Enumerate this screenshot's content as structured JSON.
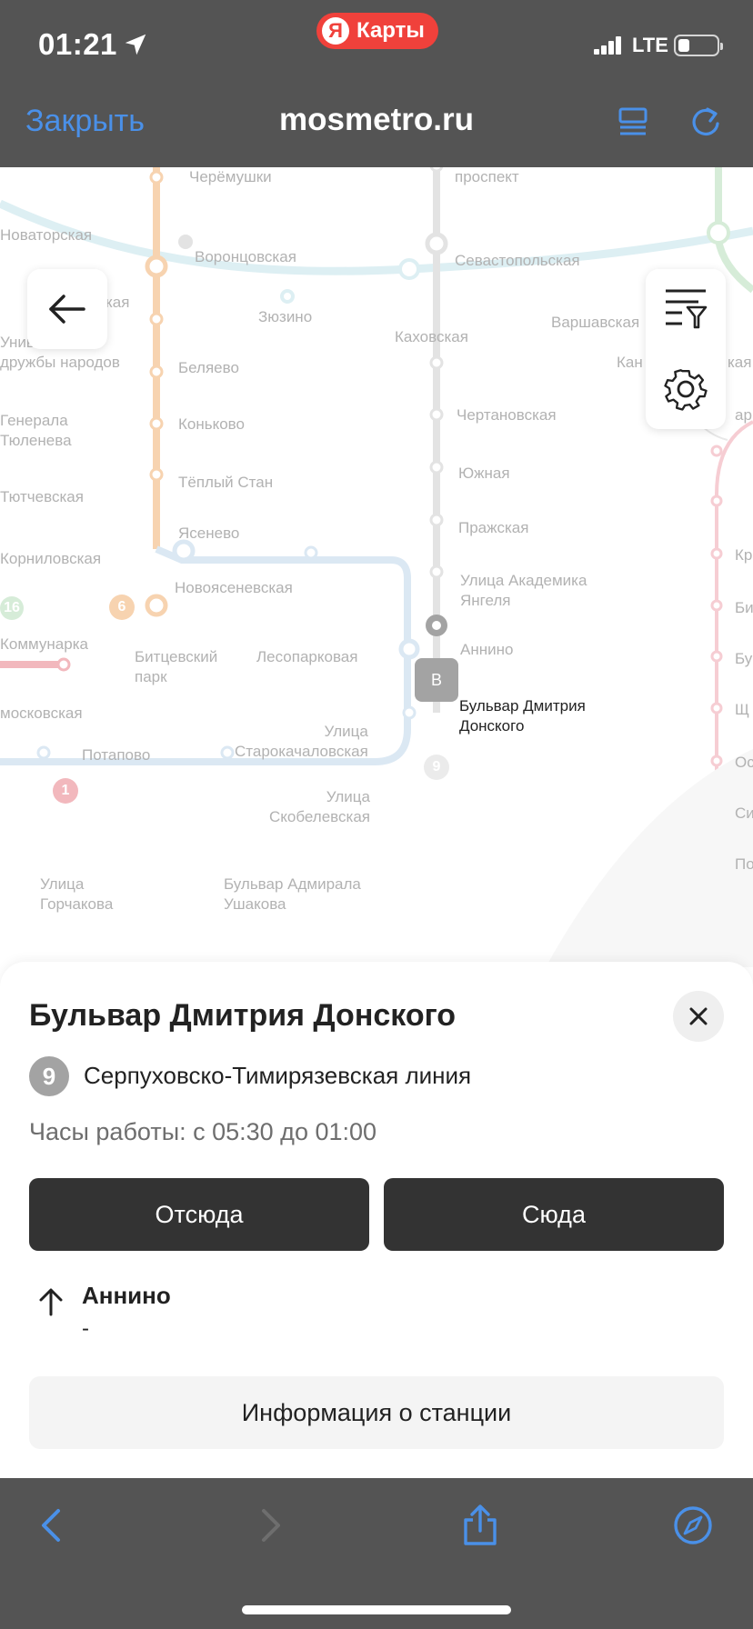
{
  "status_bar": {
    "time": "01:21",
    "app_pill": {
      "logo_letter": "Я",
      "label": "Карты"
    },
    "network": "LTE",
    "battery_level": 0.3
  },
  "nav_bar": {
    "close_label": "Закрыть",
    "title": "mosmetro.ru"
  },
  "map": {
    "labels": {
      "cheremushki": "Черёмушки",
      "prospekt": "проспект",
      "novatorskaya": "Новаторская",
      "vorontsovskaya": "Воронцовская",
      "sevastopolskaya": "Севастопольская",
      "kaya": "кая",
      "zyuzino": "Зюзино",
      "varshavskaya": "Варшавская",
      "kakhovskaya": "Каховская",
      "univ_druzhby": "Униве\nдружбы народов",
      "kan": "Кан",
      "kaya2": "кая",
      "belyaevo": "Беляево",
      "generala_tyuleneva": "Генерала\nТюленева",
      "chertanovskaya": "Чертановская",
      "kari": "ари",
      "konkovo": "Коньково",
      "teply_stan": "Тёплый Стан",
      "yuzhnaya": "Южная",
      "tyutchevskaya": "Тютчевская",
      "yasenevo": "Ясенево",
      "prazhskaya": "Пражская",
      "kr": "Кр",
      "kornilovskaya": "Корниловская",
      "ulitsa_ak_yangelya": "Улица Академика\nЯнгеля",
      "novoyasenevskaya": "Новоясеневская",
      "bi": "Би",
      "kommunarka": "Коммунарка",
      "bittsevsky_park": "Битцевский\nпарк",
      "lesoparkovaya": "Лесопарковая",
      "annino": "Аннино",
      "bu": "Бу",
      "moskovskaya": "московская",
      "bulvar_dm_donskogo": "Бульвар Дмитрия\nДонского",
      "shch": "Щ",
      "ulitsa_starokachalovskaya": "Улица\nСтарокачаловская",
      "potapovo": "Потапово",
      "os": "Ос",
      "ulitsa_skobelevskaya": "Улица\nСкобелевская",
      "si": "Си",
      "po": "По",
      "ulitsa_gorchakova": "Улица\nГорчакова",
      "bulvar_adm_ushakova": "Бульвар Адмирала\nУшакова"
    },
    "line_numbers": {
      "l16": "16",
      "l6": "6",
      "l1": "1",
      "l9": "9"
    },
    "marker_letter": "B",
    "colors": {
      "orange": "#f7d3b0",
      "grey": "#e3e3e3",
      "light_blue": "#ddeff3",
      "blue_ring": "#dbe8f3",
      "green": "#d6ecd8",
      "pink": "#f6cdd3",
      "red": "#f2b8bd"
    }
  },
  "sheet": {
    "station_name": "Бульвар Дмитрия Донского",
    "line_number": "9",
    "line_name": "Серпуховско-Тимирязевская линия",
    "hours": "Часы работы: с 05:30 до 01:00",
    "from_label": "Отсюда",
    "to_label": "Сюда",
    "direction": {
      "name": "Аннино",
      "time": "-"
    },
    "info_label": "Информация о станции",
    "line_color": "#a3a3a3"
  },
  "colors": {
    "chrome_bg": "#545454",
    "ios_blue": "#4a90e8",
    "button_dark": "#333333"
  }
}
